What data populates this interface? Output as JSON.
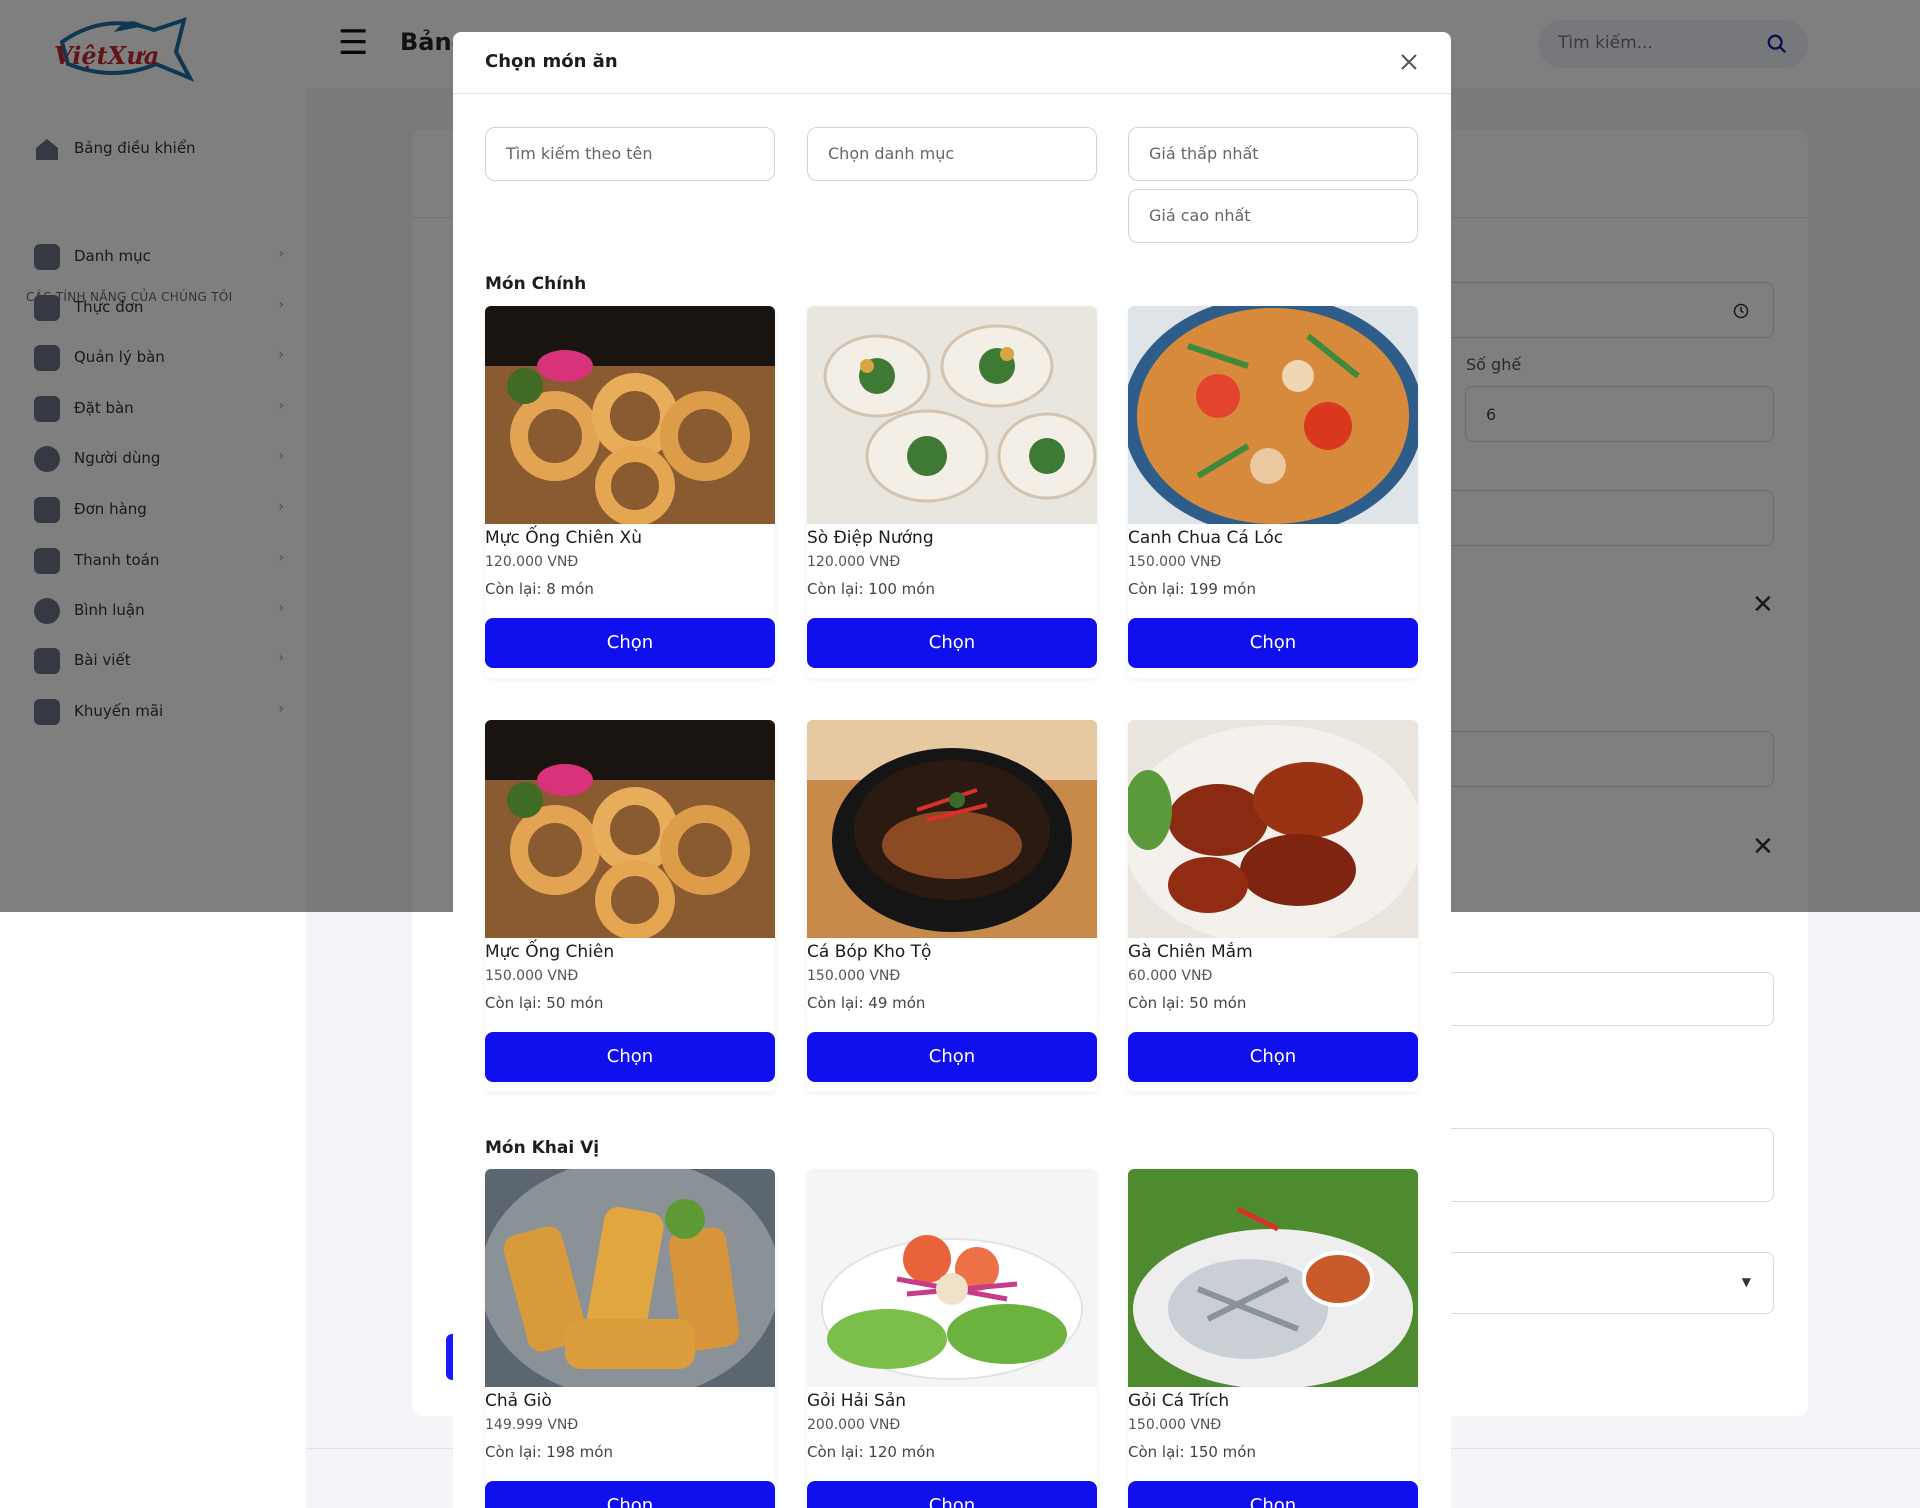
{
  "header": {
    "page_title": "Bảng",
    "search_placeholder": "Tìm kiếm..."
  },
  "sidebar": {
    "dashboard": "Bảng điều khiển",
    "section_title": "CÁC TÍNH NĂNG CỦA CHÚNG TÔI",
    "items": [
      {
        "label": "Danh mục"
      },
      {
        "label": "Thực đơn"
      },
      {
        "label": "Quản lý bàn"
      },
      {
        "label": "Đặt bàn"
      },
      {
        "label": "Người dùng"
      },
      {
        "label": "Đơn hàng"
      },
      {
        "label": "Thanh toán"
      },
      {
        "label": "Bình luận"
      },
      {
        "label": "Bài viết"
      },
      {
        "label": "Khuyến mãi"
      }
    ]
  },
  "background_form": {
    "seat_label": "Số ghế",
    "seat_value": "6"
  },
  "modal": {
    "title": "Chọn món ăn",
    "filters": {
      "name": "Tìm kiếm theo tên",
      "category": "Chọn danh mục",
      "min_price": "Giá thấp nhất",
      "max_price": "Giá cao nhất"
    },
    "select_label": "Chọn",
    "sections": [
      {
        "title": "Món Chính",
        "dishes": [
          {
            "name": "Mực Ống Chiên Xù",
            "price": "120.000 VNĐ",
            "stock": "Còn lại: 8 món"
          },
          {
            "name": "Sò Điệp Nướng",
            "price": "120.000 VNĐ",
            "stock": "Còn lại: 100 món"
          },
          {
            "name": "Canh Chua Cá Lóc",
            "price": "150.000 VNĐ",
            "stock": "Còn lại: 199 món"
          },
          {
            "name": "Mực Ống Chiên",
            "price": "150.000 VNĐ",
            "stock": "Còn lại: 50 món"
          },
          {
            "name": "Cá Bóp Kho Tộ",
            "price": "150.000 VNĐ",
            "stock": "Còn lại: 49 món"
          },
          {
            "name": "Gà Chiên Mắm",
            "price": "60.000 VNĐ",
            "stock": "Còn lại: 50 món"
          }
        ]
      },
      {
        "title": "Món Khai Vị",
        "dishes": [
          {
            "name": "Chả Giò",
            "price": "149.999 VNĐ",
            "stock": "Còn lại: 198 món"
          },
          {
            "name": "Gỏi Hải Sản",
            "price": "200.000 VNĐ",
            "stock": "Còn lại: 120 món"
          },
          {
            "name": "Gỏi Cá Trích",
            "price": "150.000 VNĐ",
            "stock": "Còn lại: 150 món"
          }
        ]
      }
    ]
  },
  "colors": {
    "primary_button": "#1010ee",
    "overlay": "rgba(0,0,0,0.5)"
  }
}
